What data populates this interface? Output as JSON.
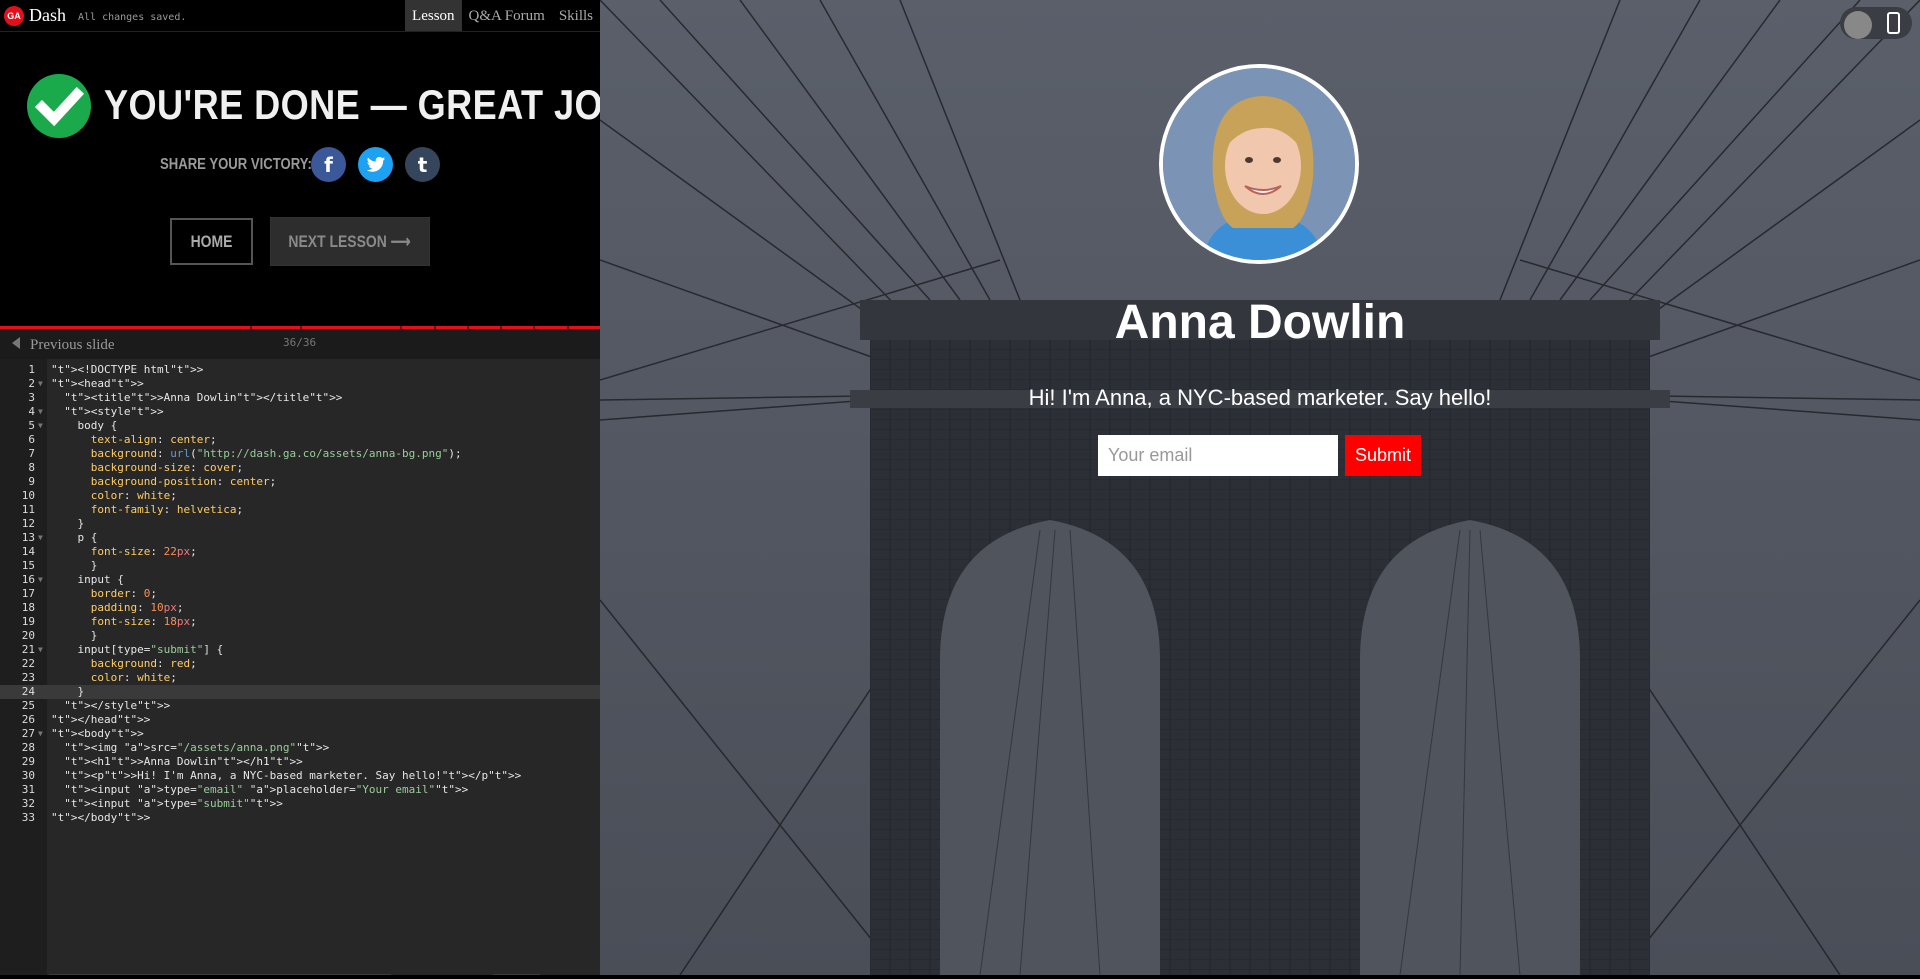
{
  "topbar": {
    "logo": "GA",
    "brand": "Dash",
    "status": "All changes saved.",
    "tabs": [
      {
        "label": "Lesson",
        "active": true
      },
      {
        "label": "Q&A Forum",
        "active": false
      },
      {
        "label": "Skills",
        "active": false
      }
    ]
  },
  "done": {
    "title": "YOU'RE DONE — GREAT JOB!",
    "share_label": "SHARE YOUR VICTORY:",
    "social": [
      {
        "icon": "facebook-icon",
        "glyph": "f",
        "color": "#3b5998"
      },
      {
        "icon": "twitter-icon",
        "glyph": "t",
        "color": "#1da1f2"
      },
      {
        "icon": "tumblr-icon",
        "glyph": "t",
        "color": "#35465c"
      }
    ],
    "home_label": "HOME",
    "next_label": "NEXT LESSON ⟶"
  },
  "slides": {
    "prev_label": "Previous slide",
    "counter": "36/36"
  },
  "editor": {
    "current_line": 24,
    "lines": [
      "<!DOCTYPE html>",
      "<head>",
      "  <title>Anna Dowlin</title>",
      "  <style>",
      "    body {",
      "      text-align: center;",
      "      background: url(\"http://dash.ga.co/assets/anna-bg.png\");",
      "      background-size: cover;",
      "      background-position: center;",
      "      color: white;",
      "      font-family: helvetica;",
      "    }",
      "    p {",
      "      font-size: 22px;",
      "      }",
      "    input {",
      "      border: 0;",
      "      padding: 10px;",
      "      font-size: 18px;",
      "      }",
      "    input[type=\"submit\"] {",
      "      background: red;",
      "      color: white;",
      "    }",
      "  </style>",
      "</head>",
      "<body>",
      "  <img src=\"/assets/anna.png\">",
      "  <h1>Anna Dowlin</h1>",
      "  <p>Hi! I'm Anna, a NYC-based marketer. Say hello!</p>",
      "  <input type=\"email\" placeholder=\"Your email\">",
      "  <input type=\"submit\">",
      "</body>"
    ]
  },
  "preview": {
    "name": "Anna Dowlin",
    "intro": "Hi! I'm Anna, a NYC-based marketer. Say hello!",
    "email_placeholder": "Your email",
    "submit_label": "Submit",
    "submit_color": "#ff0000"
  },
  "colors": {
    "accent": "#e2101a",
    "success": "#1aa94b"
  }
}
